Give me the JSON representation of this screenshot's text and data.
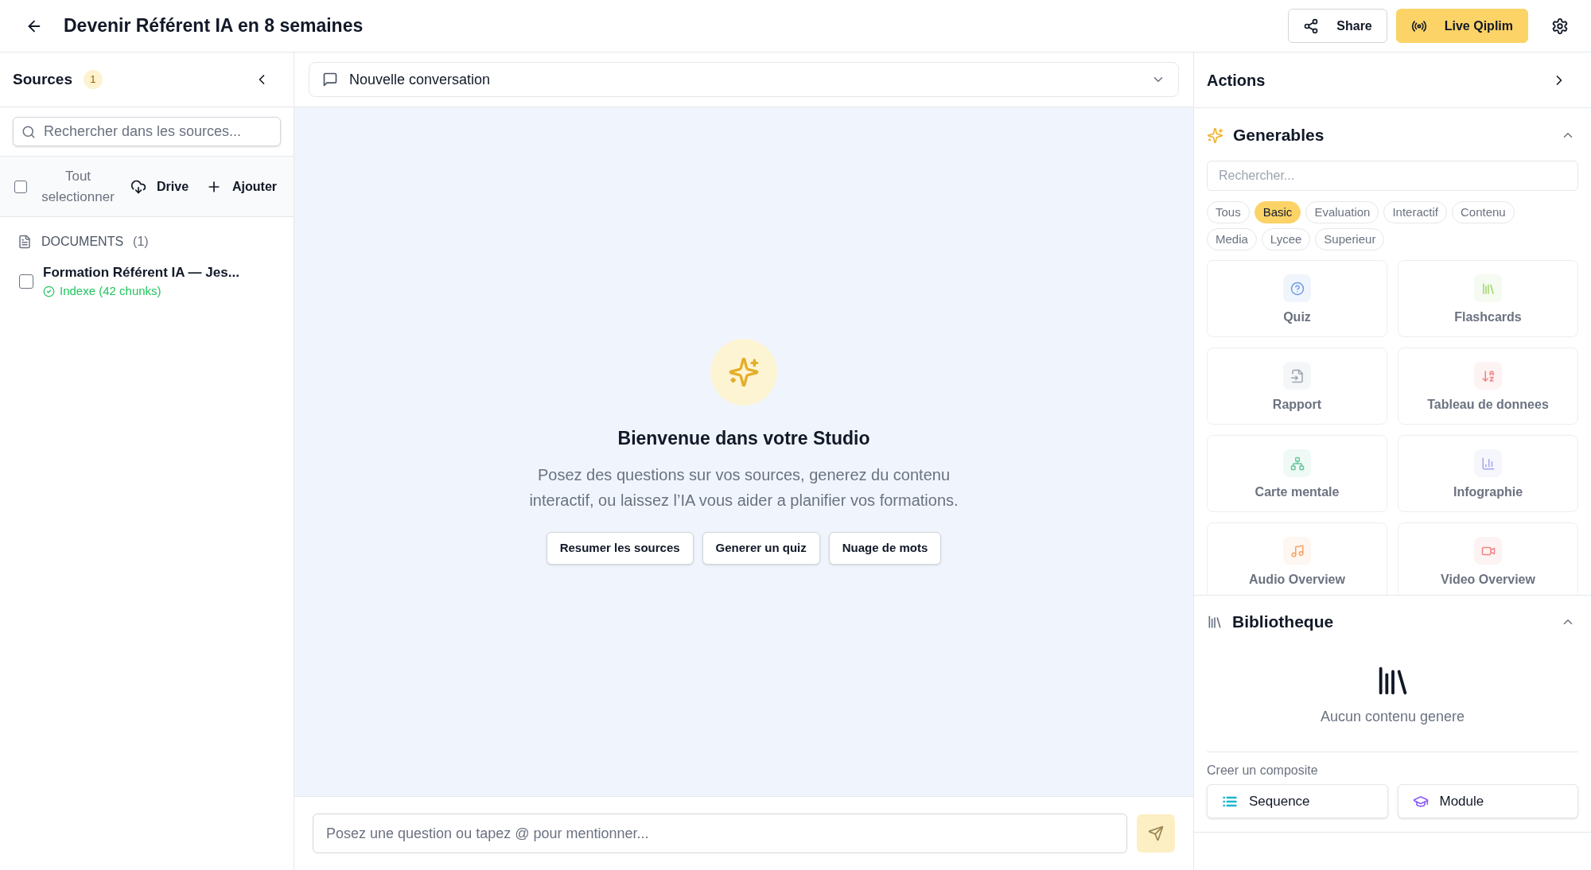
{
  "header": {
    "title": "Devenir Référent IA en 8 semaines",
    "buttons": [
      {
        "label": "Share",
        "kind": "outline"
      },
      {
        "label": "Live Qiplim",
        "kind": "primary"
      }
    ]
  },
  "sources": {
    "title": "Sources",
    "count": "1",
    "search": {
      "placeholder": "Rechercher dans les sources..."
    },
    "select_all": {
      "label": "Tout selectionner",
      "checked": false
    },
    "actions": [
      {
        "label": "Drive"
      },
      {
        "label": "Ajouter"
      }
    ],
    "group": {
      "label": "DOCUMENTS",
      "count": "(1)"
    },
    "documents": [
      {
        "title": "Formation Référent IA — Jes...",
        "status": "Indexe (42 chunks)",
        "checked": false
      }
    ]
  },
  "conversation": {
    "selector": "Nouvelle conversation",
    "welcome": {
      "title": "Bienvenue dans votre Studio",
      "text": "Posez des questions sur vos sources, generez du contenu interactif, ou laissez l’IA vous aider a planifier vos formations."
    },
    "suggestions": [
      "Resumer les sources",
      "Generer un quiz",
      "Nuage de mots"
    ],
    "input": {
      "placeholder": "Posez une question ou tapez @ pour mentionner..."
    }
  },
  "actions": {
    "title": "Actions",
    "generables": {
      "title": "Generables",
      "expanded": true,
      "search": {
        "placeholder": "Rechercher..."
      },
      "filters": [
        {
          "label": "Tous",
          "selected": false
        },
        {
          "label": "Basic",
          "selected": true
        },
        {
          "label": "Evaluation",
          "selected": false
        },
        {
          "label": "Interactif",
          "selected": false
        },
        {
          "label": "Contenu",
          "selected": false
        },
        {
          "label": "Media",
          "selected": false
        },
        {
          "label": "Lycee",
          "selected": false
        },
        {
          "label": "Superieur",
          "selected": false
        }
      ],
      "items": [
        {
          "label": "Quiz",
          "color": "#6f9be8"
        },
        {
          "label": "Flashcards",
          "color": "#9fd46e"
        },
        {
          "label": "Rapport",
          "color": "#9ca3af"
        },
        {
          "label": "Tableau de donnees",
          "color": "#ee8585"
        },
        {
          "label": "Carte mentale",
          "color": "#66c79c"
        },
        {
          "label": "Infographie",
          "color": "#a3a6ee"
        },
        {
          "label": "Audio Overview",
          "color": "#f3a468"
        },
        {
          "label": "Video Overview",
          "color": "#ee8585"
        }
      ]
    },
    "library": {
      "title": "Bibliotheque",
      "expanded": true,
      "empty_text": "Aucun contenu genere",
      "composite_label": "Creer un composite",
      "composites": [
        {
          "label": "Sequence",
          "color": "#1fb5cc"
        },
        {
          "label": "Module",
          "color": "#8b5cf6"
        }
      ]
    }
  }
}
